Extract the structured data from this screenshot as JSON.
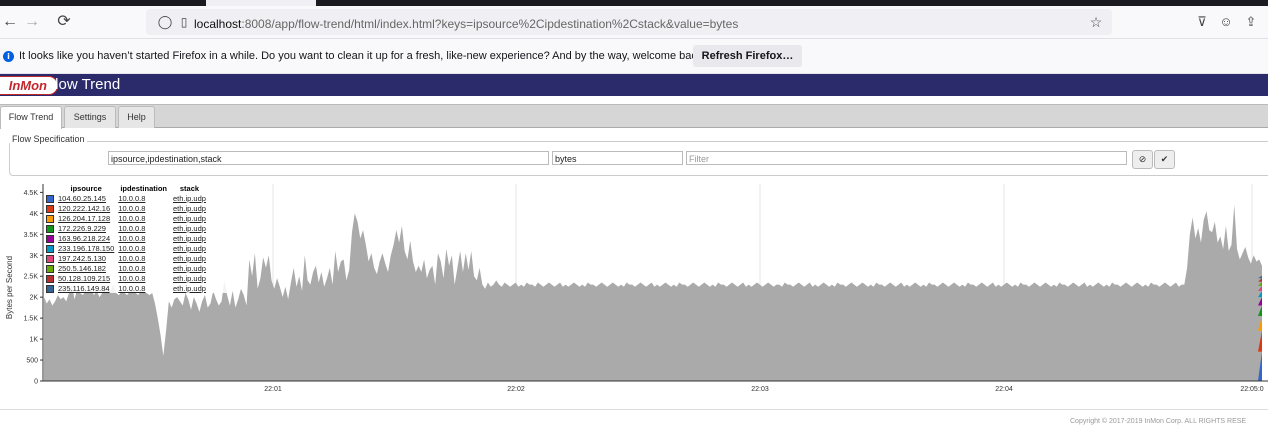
{
  "browser": {
    "url_host": "localhost",
    "url_rest": ":8008/app/flow-trend/html/index.html?keys=ipsource%2Cipdestination%2Cstack&value=bytes"
  },
  "notification": {
    "text": "It looks like you haven’t started Firefox in a while. Do you want to clean it up for a fresh, like-new experience? And by the way, welcome back!",
    "button": "Refresh Firefox…"
  },
  "app": {
    "logo": "InMon",
    "title": "Flow Trend",
    "tabs": [
      "Flow Trend",
      "Settings",
      "Help"
    ]
  },
  "flow_spec": {
    "legend": "Flow Specification",
    "keys": "ipsource,ipdestination,stack",
    "value": "bytes",
    "filter_placeholder": "Filter"
  },
  "legend": {
    "headers": [
      "ipsource",
      "ipdestination",
      "stack"
    ],
    "rows": [
      {
        "src": "104.60.25.145",
        "dst": "10.0.0.8",
        "stack": "eth.ip.udp",
        "color": "#3366cc"
      },
      {
        "src": "120.222.142.16",
        "dst": "10.0.0.8",
        "stack": "eth.ip.udp",
        "color": "#dc3912"
      },
      {
        "src": "126.204.17.128",
        "dst": "10.0.0.8",
        "stack": "eth.ip.udp",
        "color": "#ff9900"
      },
      {
        "src": "172.226.9.229",
        "dst": "10.0.0.8",
        "stack": "eth.ip.udp",
        "color": "#109618"
      },
      {
        "src": "163.96.218.224",
        "dst": "10.0.0.8",
        "stack": "eth.ip.udp",
        "color": "#990099"
      },
      {
        "src": "233.196.178.150",
        "dst": "10.0.0.8",
        "stack": "eth.ip.udp",
        "color": "#0099c6"
      },
      {
        "src": "197.242.5.130",
        "dst": "10.0.0.8",
        "stack": "eth.ip.udp",
        "color": "#dd4477"
      },
      {
        "src": "250.5.146.182",
        "dst": "10.0.0.8",
        "stack": "eth.ip.udp",
        "color": "#66aa00"
      },
      {
        "src": "50.128.109.215",
        "dst": "10.0.0.8",
        "stack": "eth.ip.udp",
        "color": "#b82e2e"
      },
      {
        "src": "235.116.149.84",
        "dst": "10.0.0.8",
        "stack": "eth.ip.udp",
        "color": "#316395"
      }
    ]
  },
  "chart_data": {
    "type": "area",
    "ylabel": "Bytes per Second",
    "ylim": [
      0,
      4700
    ],
    "yticks": [
      0,
      500,
      1000,
      1500,
      2000,
      2500,
      3000,
      3500,
      4000,
      4500
    ],
    "ytick_labels": [
      "0",
      "500",
      "1K",
      "1.5K",
      "2K",
      "2.5K",
      "3K",
      "3.5K",
      "4K",
      "4.5K"
    ],
    "xticks": [
      "22:01",
      "22:02",
      "22:03",
      "22:04",
      "22:05:0"
    ],
    "series_color": "#aaaaaa",
    "values": [
      2000,
      1850,
      1950,
      1800,
      1900,
      2050,
      1950,
      2000,
      1900,
      2100,
      2300,
      1950,
      2200,
      2100,
      2050,
      2150,
      2100,
      2200,
      2050,
      2150,
      2000,
      2100,
      2250,
      2200,
      2150,
      2300,
      2100,
      2050,
      2150,
      2100,
      2050,
      2150,
      2200,
      2100,
      2050,
      2200,
      2150,
      2100,
      2050,
      2100,
      1850,
      1500,
      1100,
      600,
      1200,
      1900,
      1750,
      1950,
      2000,
      1900,
      1800,
      2100,
      1950,
      1700,
      2000,
      1850,
      1650,
      1900,
      2050,
      1750,
      1850,
      2150,
      1950,
      1800,
      1900,
      2400,
      2050,
      1800,
      2150,
      1750,
      1950,
      2200,
      2050,
      1800,
      2900,
      2500,
      3050,
      2200,
      2450,
      2950,
      2700,
      3000,
      2400,
      2200,
      2450,
      2250,
      2000,
      2250,
      1950,
      2350,
      2700,
      2250,
      2500,
      2150,
      3000,
      2400,
      2300,
      2600,
      2750,
      2350,
      2600,
      2250,
      2450,
      2700,
      2300,
      3100,
      2600,
      2850,
      2900,
      2400,
      2650,
      3550,
      4000,
      3800,
      3400,
      3600,
      3250,
      2850,
      3050,
      2700,
      2550,
      2850,
      3050,
      2800,
      2600,
      3000,
      3250,
      3600,
      3300,
      3700,
      3100,
      2900,
      3350,
      2850,
      2600,
      2750,
      2600,
      2900,
      2450,
      2650,
      2750,
      2300,
      3050,
      2850,
      2450,
      3150,
      2750,
      3000,
      2300,
      2700,
      3100,
      2600,
      3050,
      2650,
      3100,
      2500,
      2400,
      2700,
      2300,
      2200,
      2350,
      2250,
      2300,
      2400,
      2300,
      2250,
      2350,
      2300,
      2250,
      2300,
      2350,
      2250,
      2300,
      2250,
      2350,
      2300,
      2300,
      2250,
      2350,
      2300,
      2250,
      2300,
      2350,
      2300,
      2250,
      2300,
      2350,
      2250,
      2300,
      2250,
      2300,
      2350,
      2300,
      2250,
      2300,
      2250,
      2350,
      2300,
      2300,
      2250,
      2300,
      2350,
      2300,
      2250,
      2300,
      2350,
      2300,
      2250,
      2300,
      2250,
      2350,
      2300,
      2300,
      2250,
      2300,
      2350,
      2300,
      2250,
      2300,
      2350,
      2250,
      2300,
      2250,
      2300,
      2350,
      2300,
      2250,
      2300,
      2250,
      2350,
      2300,
      2300,
      2250,
      2300,
      2350,
      2300,
      2250,
      2300,
      2350,
      2300,
      2250,
      2300,
      2250,
      2350,
      2300,
      2300,
      2250,
      2300,
      2350,
      2300,
      2250,
      2300,
      2350,
      2250,
      2300,
      2250,
      2300,
      2350,
      2300,
      2250,
      2300,
      2350,
      2300,
      2250,
      2300,
      2300,
      2250,
      2350,
      2300,
      2300,
      2250,
      2300,
      2350,
      2300,
      2250,
      2300,
      2350,
      2250,
      2300,
      2250,
      2300,
      2350,
      2300,
      2250,
      2300,
      2250,
      2350,
      2300,
      2300,
      2250,
      2300,
      2350,
      2300,
      2250,
      2300,
      2350,
      2300,
      2250,
      2300,
      2250,
      2350,
      2300,
      2300,
      2250,
      2300,
      2350,
      2300,
      2250,
      2300,
      2350,
      2250,
      2300,
      2250,
      2300,
      2350,
      2300,
      2250,
      2300,
      2250,
      2350,
      2300,
      2300,
      2250,
      2300,
      2350,
      2300,
      2250,
      2300,
      2350,
      2300,
      2250,
      2300,
      2250,
      2350,
      2300,
      2300,
      2250,
      2300,
      2350,
      2300,
      2250,
      2300,
      2350,
      2250,
      2300,
      2250,
      2300,
      2350,
      2300,
      2250,
      2300,
      2250,
      2350,
      2300,
      2300,
      2250,
      2300,
      2350,
      2300,
      2250,
      2300,
      2350,
      2300,
      2250,
      2300,
      2250,
      2350,
      2300,
      2300,
      2250,
      2300,
      2350,
      2300,
      2250,
      2300,
      2350,
      2250,
      2300,
      2250,
      2300,
      2350,
      2300,
      2250,
      2300,
      2250,
      2350,
      2300,
      2300,
      2250,
      2300,
      2350,
      2300,
      2250,
      2300,
      2350,
      2300,
      2250,
      2300,
      2250,
      2350,
      2300,
      2300,
      2250,
      2300,
      2350,
      2300,
      2250,
      2300,
      2350,
      2250,
      2300,
      2300,
      2700,
      3500,
      3900,
      3400,
      3650,
      3300,
      3850,
      4050,
      3600,
      3550,
      3800,
      3300,
      3450,
      3150,
      3700,
      3100,
      3250,
      4200,
      3150,
      2900,
      3050,
      3200,
      2950,
      2800,
      3000,
      2850,
      2900,
      2750
    ],
    "legend_position": "top-left"
  },
  "footer": {
    "copyright": "Copyright © 2017-2019 InMon Corp. ALL RIGHTS RESE"
  }
}
